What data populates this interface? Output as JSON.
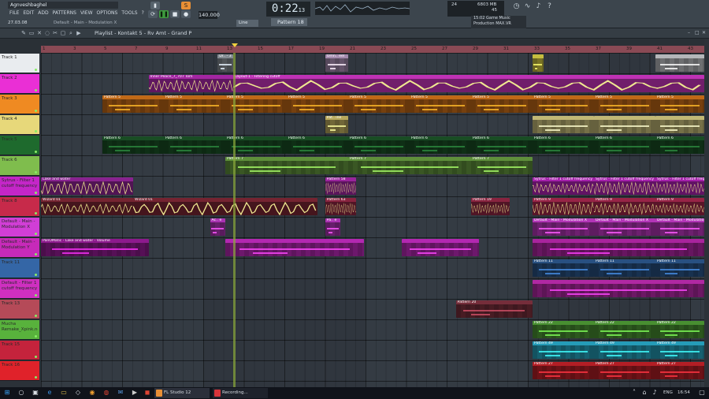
{
  "window": {
    "user": "Agnveshbaghel",
    "version_hint": "27.03.08"
  },
  "menu": [
    "FILE",
    "EDIT",
    "ADD",
    "PATTERNS",
    "VIEW",
    "OPTIONS",
    "TOOLS",
    "?"
  ],
  "hint_bar": "Default - Main - Modulation X",
  "transport": {
    "pat_label": "PAT",
    "song_label": "SONG",
    "tempo": "140.000",
    "time": "0:22",
    "time_small": "13",
    "pattern": "Pattern 18",
    "line_mode": "Line"
  },
  "cpu": {
    "poly": "24",
    "mem": "6803 MB",
    "ram": "45"
  },
  "news": {
    "time": "15:02",
    "line1": "Game Music",
    "line2": "Production MAX.VR"
  },
  "playlist": {
    "title": "Playlist - Kontakt 5 - Rv Amt - Grand P"
  },
  "ruler": [
    {
      "n": "1"
    },
    {
      "n": "3"
    },
    {
      "n": "5"
    },
    {
      "n": "7"
    },
    {
      "n": "9"
    },
    {
      "n": "11"
    },
    {
      "n": "13"
    },
    {
      "n": "15"
    },
    {
      "n": "17"
    },
    {
      "n": "19"
    },
    {
      "n": "21"
    },
    {
      "n": "23"
    },
    {
      "n": "25"
    },
    {
      "n": "27"
    },
    {
      "n": "29"
    },
    {
      "n": "31"
    },
    {
      "n": "33"
    },
    {
      "n": "35"
    },
    {
      "n": "37"
    },
    {
      "n": "39"
    },
    {
      "n": "41"
    },
    {
      "n": "43"
    }
  ],
  "tracks": [
    {
      "name": "Track 1",
      "color": "#e9ecef"
    },
    {
      "name": "Track 2",
      "color": "#ea2fd5"
    },
    {
      "name": "Track 3",
      "color": "#ef8a22"
    },
    {
      "name": "Track 4",
      "color": "#e7d87a"
    },
    {
      "name": "Track 5",
      "color": "#1e6a2d"
    },
    {
      "name": "Track 6",
      "color": "#7fbd4d"
    },
    {
      "name": "Sytrus - Filter 1 cutoff frequency",
      "color": "#c426c8"
    },
    {
      "name": "Track 8",
      "color": "#c72a4a"
    },
    {
      "name": "Default - Main - Modulation X",
      "color": "#d13ed6"
    },
    {
      "name": "Default - Main - Modulation Y",
      "color": "#c72ab9"
    },
    {
      "name": "Track 11",
      "color": "#3466a6"
    },
    {
      "name": "Default - Filter 1 cutoff frequency",
      "color": "#cf2fc0"
    },
    {
      "name": "Track 13",
      "color": "#b54a58"
    },
    {
      "name": "Mucha Remake_Xpink.noi",
      "color": "#58b23c"
    },
    {
      "name": "Track 15",
      "color": "#c4233c"
    },
    {
      "name": "Track 16",
      "color": "#e0222a"
    }
  ],
  "clips": [
    {
      "t": 0,
      "s": 12.5,
      "e": 13.5,
      "label": "Dr.. - 3",
      "color": "#9aa2aa"
    },
    {
      "t": 0,
      "s": 19.5,
      "e": 21,
      "label": "Omn.. eel",
      "color": "#c0a2cc"
    },
    {
      "t": 0,
      "s": 33,
      "e": 33.7,
      "label": "",
      "color": "#e8de4a"
    },
    {
      "t": 0,
      "s": 41,
      "e": 44.7,
      "label": "",
      "color": "#d4d6da"
    },
    {
      "t": 1,
      "s": 8,
      "e": 13.5,
      "label": "Inner Peace_7_707 Tom",
      "color": "#c02dbf"
    },
    {
      "t": 1,
      "s": 13.5,
      "e": 45,
      "label": "Layout-1 - Filtering cutoff",
      "color": "#e13bd5"
    },
    {
      "t": 2,
      "s": 5,
      "e": 9,
      "label": "Pattern 5",
      "color": "#e27b1b"
    },
    {
      "t": 2,
      "s": 9,
      "e": 13,
      "label": "Pattern 5",
      "color": "#e27b1b"
    },
    {
      "t": 2,
      "s": 13,
      "e": 17,
      "label": "Pattern 5",
      "color": "#e27b1b"
    },
    {
      "t": 2,
      "s": 17,
      "e": 21,
      "label": "Pattern 5",
      "color": "#e27b1b"
    },
    {
      "t": 2,
      "s": 21,
      "e": 25,
      "label": "Pattern 5",
      "color": "#e27b1b"
    },
    {
      "t": 2,
      "s": 25,
      "e": 29,
      "label": "Pattern 5",
      "color": "#e27b1b"
    },
    {
      "t": 2,
      "s": 29,
      "e": 33,
      "label": "Pattern 5",
      "color": "#e27b1b"
    },
    {
      "t": 2,
      "s": 33,
      "e": 37,
      "label": "Pattern 5",
      "color": "#e27b1b"
    },
    {
      "t": 2,
      "s": 37,
      "e": 41,
      "label": "Pattern 5",
      "color": "#e27b1b"
    },
    {
      "t": 2,
      "s": 41,
      "e": 45,
      "label": "Pattern 5",
      "color": "#e27b1b"
    },
    {
      "t": 3,
      "s": 19.5,
      "e": 21,
      "label": "Pat.. ine",
      "color": "#d9c66c"
    },
    {
      "t": 3,
      "s": 33,
      "e": 37,
      "label": "",
      "color": "#e3d88a"
    },
    {
      "t": 3,
      "s": 37,
      "e": 41,
      "label": "",
      "color": "#e3d88a"
    },
    {
      "t": 3,
      "s": 41,
      "e": 45,
      "label": "",
      "color": "#e3d88a"
    },
    {
      "t": 4,
      "s": 5,
      "e": 9,
      "label": "Pattern 6",
      "color": "#1d5b2a"
    },
    {
      "t": 4,
      "s": 9,
      "e": 13,
      "label": "Pattern 6",
      "color": "#1d5b2a"
    },
    {
      "t": 4,
      "s": 13,
      "e": 17,
      "label": "Pattern 6",
      "color": "#1d5b2a"
    },
    {
      "t": 4,
      "s": 17,
      "e": 21,
      "label": "Pattern 6",
      "color": "#1d5b2a"
    },
    {
      "t": 4,
      "s": 21,
      "e": 25,
      "label": "Pattern 6",
      "color": "#1d5b2a"
    },
    {
      "t": 4,
      "s": 25,
      "e": 29,
      "label": "Pattern 6",
      "color": "#1d5b2a"
    },
    {
      "t": 4,
      "s": 29,
      "e": 33,
      "label": "Pattern 6",
      "color": "#1d5b2a"
    },
    {
      "t": 4,
      "s": 33,
      "e": 37,
      "label": "Pattern 6",
      "color": "#1d5b2a"
    },
    {
      "t": 4,
      "s": 37,
      "e": 41,
      "label": "Pattern 6",
      "color": "#1d5b2a"
    },
    {
      "t": 4,
      "s": 41,
      "e": 45,
      "label": "Pattern 6",
      "color": "#1d5b2a"
    },
    {
      "t": 5,
      "s": 13,
      "e": 21,
      "label": "Pattern 7",
      "color": "#6fa845"
    },
    {
      "t": 5,
      "s": 21,
      "e": 29,
      "label": "Pattern 7",
      "color": "#6fa845"
    },
    {
      "t": 5,
      "s": 29,
      "e": 33,
      "label": "Pattern 7",
      "color": "#6fa845"
    },
    {
      "t": 6,
      "s": 1,
      "e": 7,
      "label": "Lake and water",
      "color": "#a128a8"
    },
    {
      "t": 6,
      "s": 19.5,
      "e": 21.5,
      "label": "Pattern 58",
      "color": "#b42ab6"
    },
    {
      "t": 6,
      "s": 33,
      "e": 37,
      "label": "Sytrus - Filter 1 cutoff frequency",
      "color": "#c126c8"
    },
    {
      "t": 6,
      "s": 37,
      "e": 41,
      "label": "Sytrus - Filter 1 cutoff frequency",
      "color": "#c126c8"
    },
    {
      "t": 6,
      "s": 41,
      "e": 45,
      "label": "Sytrus - Filter 1 cutoff frequency",
      "color": "#c126c8"
    },
    {
      "t": 7,
      "s": 1,
      "e": 7,
      "label": "Wizard 01",
      "color": "#8a2a3a"
    },
    {
      "t": 7,
      "s": 7,
      "e": 19,
      "label": "Wizard 01",
      "color": "#8a2a3a"
    },
    {
      "t": 7,
      "s": 19.5,
      "e": 21.5,
      "label": "Pattern 63",
      "color": "#a02a4a"
    },
    {
      "t": 7,
      "s": 29,
      "e": 31.5,
      "label": "Pattern 19",
      "color": "#a02a4a"
    },
    {
      "t": 7,
      "s": 33,
      "e": 37,
      "label": "Pattern 9",
      "color": "#b22a52"
    },
    {
      "t": 7,
      "s": 37,
      "e": 41,
      "label": "Pattern 9",
      "color": "#b22a52"
    },
    {
      "t": 7,
      "s": 41,
      "e": 45,
      "label": "Pattern 9",
      "color": "#b22a52"
    },
    {
      "t": 8,
      "s": 12,
      "e": 13,
      "label": "Ac.. e",
      "color": "#c73bd0"
    },
    {
      "t": 8,
      "s": 19.5,
      "e": 20.5,
      "label": "Pa.. e",
      "color": "#c73bd0"
    },
    {
      "t": 8,
      "s": 33,
      "e": 37,
      "label": "Default - Main - Modulation X",
      "color": "#d13ed6"
    },
    {
      "t": 8,
      "s": 37,
      "e": 41,
      "label": "Default - Main - Modulation X",
      "color": "#d13ed6"
    },
    {
      "t": 8,
      "s": 41,
      "e": 45,
      "label": "Default - Main - Modulation X",
      "color": "#d13ed6"
    },
    {
      "t": 9,
      "s": 1,
      "e": 8,
      "label": "PanOMatic - Lake and water - Volume",
      "color": "#a61fa6"
    },
    {
      "t": 9,
      "s": 13,
      "e": 22,
      "label": "",
      "color": "#d22fd0"
    },
    {
      "t": 9,
      "s": 24.5,
      "e": 29.5,
      "label": "",
      "color": "#d22fd0"
    },
    {
      "t": 9,
      "s": 33,
      "e": 45,
      "label": "",
      "color": "#c72ab9"
    },
    {
      "t": 10,
      "s": 33,
      "e": 37,
      "label": "Pattern 11",
      "color": "#2f5e98"
    },
    {
      "t": 10,
      "s": 37,
      "e": 41,
      "label": "Pattern 11",
      "color": "#2f5e98"
    },
    {
      "t": 10,
      "s": 41,
      "e": 45,
      "label": "Pattern 11",
      "color": "#2f5e98"
    },
    {
      "t": 11,
      "s": 33,
      "e": 45,
      "label": "",
      "color": "#cf2fc0"
    },
    {
      "t": 12,
      "s": 28,
      "e": 33,
      "label": "Pattern 20",
      "color": "#8a3544"
    },
    {
      "t": 13,
      "s": 33,
      "e": 37,
      "label": "Pattern 22",
      "color": "#55a83a"
    },
    {
      "t": 13,
      "s": 37,
      "e": 41,
      "label": "Pattern 22",
      "color": "#55a83a"
    },
    {
      "t": 13,
      "s": 41,
      "e": 45,
      "label": "Pattern 22",
      "color": "#55a83a"
    },
    {
      "t": 14,
      "s": 33,
      "e": 37,
      "label": "Pattern 49",
      "color": "#2bb8d8"
    },
    {
      "t": 14,
      "s": 37,
      "e": 41,
      "label": "Pattern 49",
      "color": "#2bb8d8"
    },
    {
      "t": 14,
      "s": 41,
      "e": 45,
      "label": "Pattern 49",
      "color": "#2bb8d8"
    },
    {
      "t": 15,
      "s": 33,
      "e": 37,
      "label": "Pattern 27",
      "color": "#d2232c"
    },
    {
      "t": 15,
      "s": 37,
      "e": 41,
      "label": "Pattern 27",
      "color": "#d2232c"
    },
    {
      "t": 15,
      "s": 41,
      "e": 45,
      "label": "Pattern 27",
      "color": "#d2232c"
    }
  ],
  "taskbar": {
    "apps": [
      {
        "label": "FL Studio 12",
        "color": "#e98f35"
      },
      {
        "label": "Recording...",
        "color": "#d8343a"
      }
    ],
    "lang": "ENG",
    "clock": "16:54"
  }
}
